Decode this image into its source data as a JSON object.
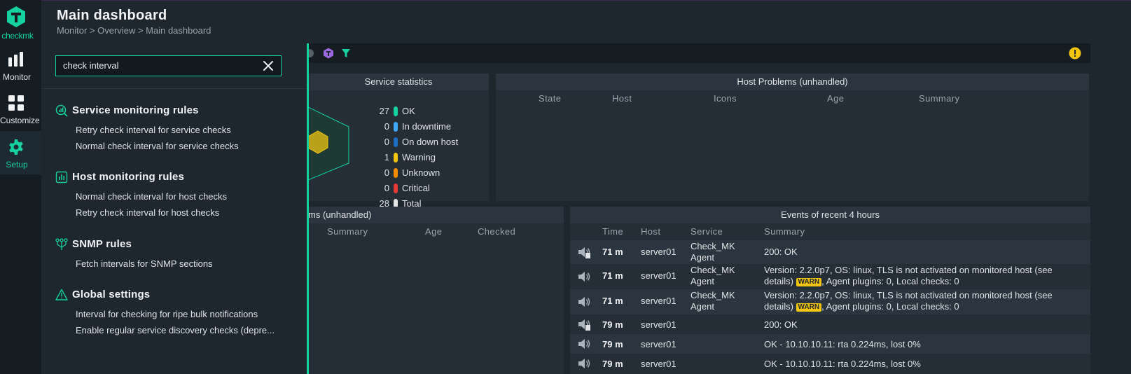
{
  "nav": {
    "logo_text": "checkmk",
    "items": [
      {
        "label": "Monitor",
        "icon": "bar-chart-icon"
      },
      {
        "label": "Customize",
        "icon": "grid-icon"
      },
      {
        "label": "Setup",
        "icon": "gear-icon"
      }
    ]
  },
  "header": {
    "title": "Main dashboard",
    "breadcrumb": "Monitor > Overview > Main dashboard"
  },
  "search": {
    "value": "check interval",
    "groups": [
      {
        "title": "Service monitoring rules",
        "icon": "service-rules-icon",
        "results": [
          "Retry check interval for service checks",
          "Normal check interval for service checks"
        ]
      },
      {
        "title": "Host monitoring rules",
        "icon": "host-rules-icon",
        "results": [
          "Normal check interval for host checks",
          "Retry check interval for host checks"
        ]
      },
      {
        "title": "SNMP rules",
        "icon": "snmp-icon",
        "results": [
          "Fetch intervals for SNMP sections"
        ]
      },
      {
        "title": "Global settings",
        "icon": "warning-triangle-icon",
        "results": [
          "Interval for checking for ripe bulk notifications",
          "Enable regular service discovery checks (depre..."
        ]
      }
    ]
  },
  "service_stats": {
    "title": "Service statistics",
    "rows": [
      {
        "count": "27",
        "label": "OK",
        "color": "#15d1a0"
      },
      {
        "count": "0",
        "label": "In downtime",
        "color": "#3fa9f5"
      },
      {
        "count": "0",
        "label": "On down host",
        "color": "#1e6fbf"
      },
      {
        "count": "1",
        "label": "Warning",
        "color": "#f1c40f"
      },
      {
        "count": "0",
        "label": "Unknown",
        "color": "#f08c00"
      },
      {
        "count": "0",
        "label": "Critical",
        "color": "#e53935"
      },
      {
        "count": "28",
        "label": "Total",
        "color": "#e6e6e6"
      }
    ]
  },
  "host_problems": {
    "title": "Host Problems (unhandled)",
    "columns": [
      "State",
      "Host",
      "Icons",
      "Age",
      "Summary"
    ]
  },
  "service_problems": {
    "title": "ms (unhandled)",
    "columns": [
      "Summary",
      "Age",
      "Checked"
    ]
  },
  "events": {
    "title": "Events of recent 4 hours",
    "columns": [
      "Time",
      "Host",
      "Service",
      "Summary"
    ],
    "rows": [
      {
        "time": "71 m",
        "host": "server01",
        "service1": "Check_MK",
        "service2": "Agent",
        "sum1": "200: OK",
        "sum2": "",
        "sum3": ""
      },
      {
        "time": "71 m",
        "host": "server01",
        "service1": "Check_MK",
        "service2": "Agent",
        "sum1": "Version: 2.2.0p7, OS: linux, TLS is not activated on monitored host (see",
        "sum2": "details)",
        "warn": "WARN",
        "sum3": ", Agent plugins: 0, Local checks: 0"
      },
      {
        "time": "71 m",
        "host": "server01",
        "service1": "Check_MK",
        "service2": "Agent",
        "sum1": "Version: 2.2.0p7, OS: linux, TLS is not activated on monitored host (see",
        "sum2": "details)",
        "warn": "WARN",
        "sum3": ", Agent plugins: 0, Local checks: 0"
      },
      {
        "time": "79 m",
        "host": "server01",
        "service1": "",
        "service2": "",
        "sum1": "200: OK",
        "sum2": "",
        "sum3": ""
      },
      {
        "time": "79 m",
        "host": "server01",
        "service1": "",
        "service2": "",
        "sum1": "OK - 10.10.10.11: rta 0.224ms, lost 0%",
        "sum2": "",
        "sum3": ""
      },
      {
        "time": "79 m",
        "host": "server01",
        "service1": "",
        "service2": "",
        "sum1": "OK - 10.10.10.11: rta 0.224ms, lost 0%",
        "sum2": "",
        "sum3": ""
      }
    ]
  }
}
